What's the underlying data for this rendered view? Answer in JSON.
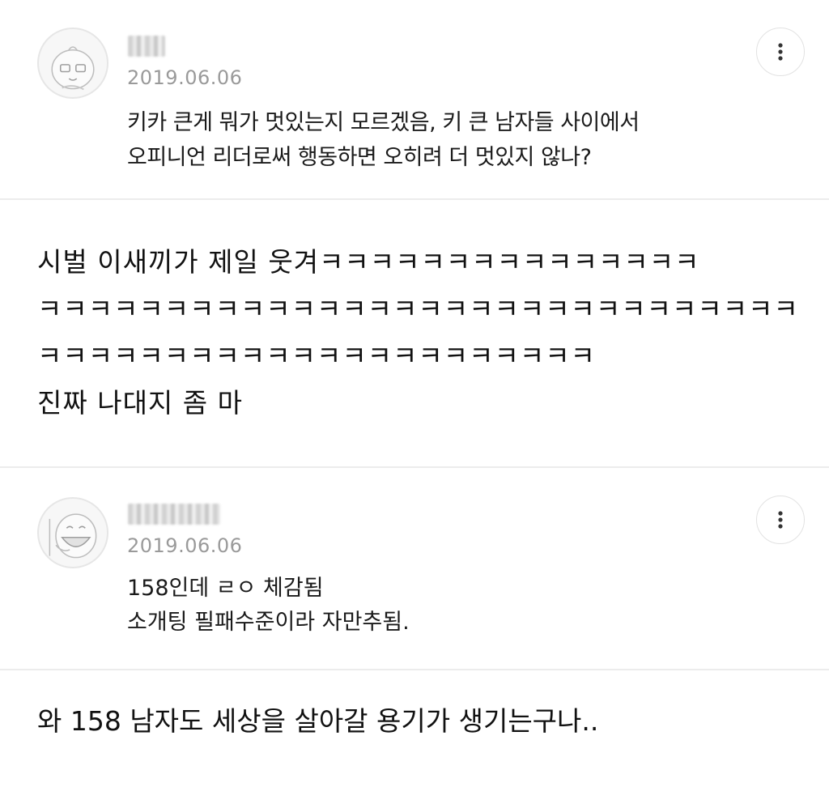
{
  "comments": [
    {
      "date": "2019.06.06",
      "avatar_icon": "peach-character-icon",
      "text": "키카 큰게 뭐가 멋있는지 모르겠음, 키 큰 남자들 사이에서\n오피니언 리더로써 행동하면 오히려 더 멋있지 않나?"
    },
    {
      "date": "2019.06.06",
      "avatar_icon": "laughing-character-icon",
      "text": "158인데 ㄹㅇ 체감됨\n소개팅 필패수준이라 자만추됨."
    }
  ],
  "replies": [
    {
      "text": "시벌 이새끼가 제일 웃겨ㅋㅋㅋㅋㅋㅋㅋㅋㅋㅋㅋㅋㅋㅋㅋ\nㅋㅋㅋㅋㅋㅋㅋㅋㅋㅋㅋㅋㅋㅋㅋㅋㅋㅋㅋㅋㅋㅋㅋㅋㅋㅋㅋㅋㅋㅋ\nㅋㅋㅋㅋㅋㅋㅋㅋㅋㅋㅋㅋㅋㅋㅋㅋㅋㅋㅋㅋㅋㅋ\n진짜 나대지 좀 마"
    },
    {
      "text": "와 158 남자도 세상을 살아갈 용기가 생기는구나.."
    }
  ],
  "icons": {
    "more": "more-vertical-icon"
  },
  "colors": {
    "date": "#9a9a9a",
    "divider": "#ececec",
    "text": "#1a1a1a"
  }
}
